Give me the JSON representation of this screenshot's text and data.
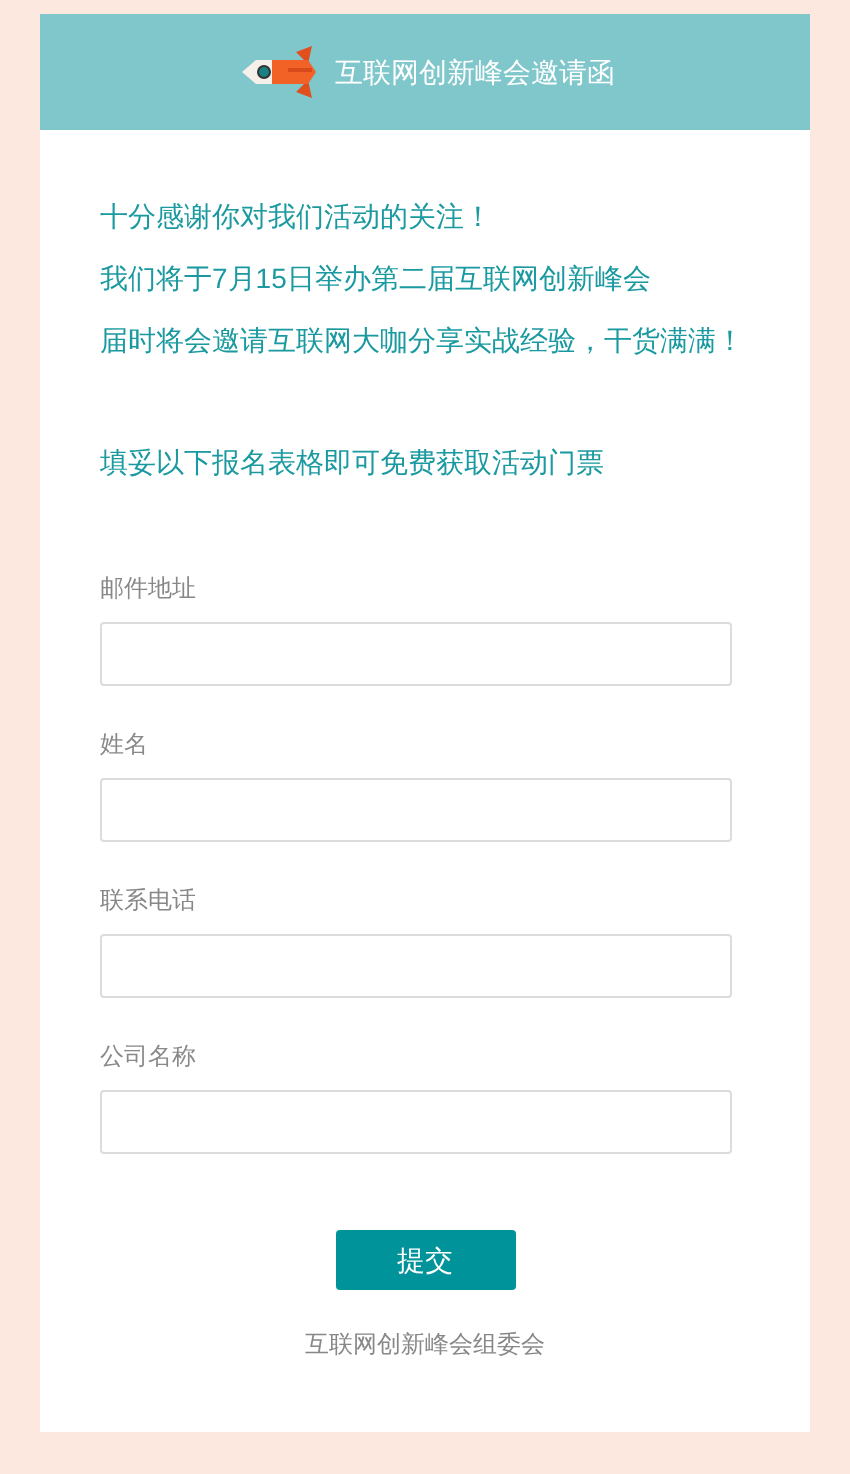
{
  "header": {
    "title": "互联网创新峰会邀请函"
  },
  "intro": [
    "十分感谢你对我们活动的关注！",
    "我们将于7月15日举办第二届互联网创新峰会",
    "届时将会邀请互联网大咖分享实战经验，干货满满！"
  ],
  "call_to_action": "填妥以下报名表格即可免费获取活动门票",
  "fields": [
    {
      "label": "邮件地址"
    },
    {
      "label": "姓名"
    },
    {
      "label": "联系电话"
    },
    {
      "label": "公司名称"
    }
  ],
  "submit_button": "提交",
  "footer": "互联网创新峰会组委会"
}
